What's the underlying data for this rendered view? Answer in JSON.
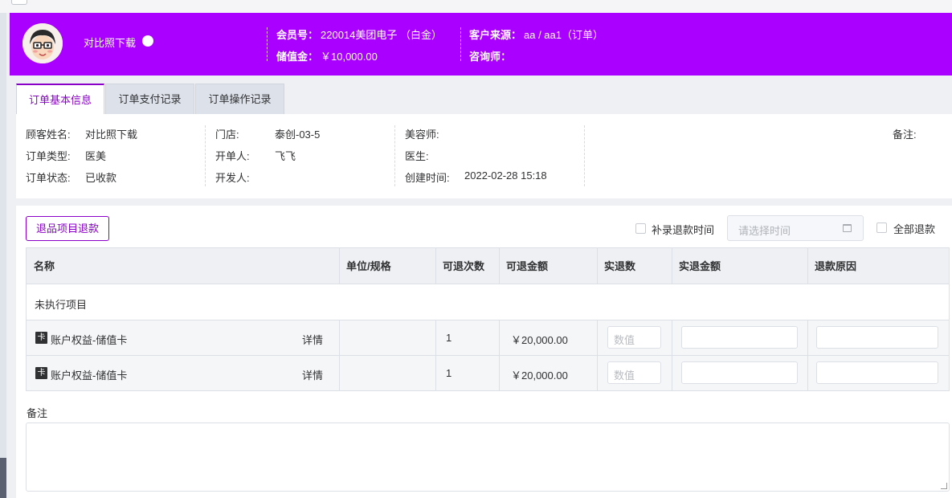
{
  "header": {
    "customer_name": "对比照下载",
    "member_label": "会员号：",
    "member_value": "220014美团电子 （白金）",
    "balance_label": "储值金：",
    "balance_value": "￥10,000.00",
    "source_label": "客户来源：",
    "source_value": "aa / aa1（订单）",
    "consultant_label": "咨询师：",
    "consultant_value": "",
    "bg_color": "#aa00ff"
  },
  "tabs": [
    {
      "label": "订单基本信息",
      "active": true
    },
    {
      "label": "订单支付记录",
      "active": false
    },
    {
      "label": "订单操作记录",
      "active": false
    }
  ],
  "info": {
    "customer_name_label": "顾客姓名:",
    "customer_name_value": "对比照下载",
    "order_type_label": "订单类型:",
    "order_type_value": "医美",
    "order_status_label": "订单状态:",
    "order_status_value": "已收款",
    "store_label": "门店:",
    "store_value": "泰创-03-5",
    "issuer_label": "开单人:",
    "issuer_value": "飞飞",
    "developer_label": "开发人:",
    "developer_value": "",
    "beautician_label": "美容师:",
    "beautician_value": "",
    "doctor_label": "医生:",
    "doctor_value": "",
    "created_label": "创建时间:",
    "created_value": "2022-02-28 15:18",
    "remark_label": "备注:"
  },
  "toolbar": {
    "refund_button": "退品项目退款",
    "supplement_time_label": "补录退款时间",
    "date_placeholder": "请选择时间",
    "full_refund_label": "全部退款"
  },
  "table": {
    "columns": [
      "名称",
      "单位/规格",
      "可退次数",
      "可退金额",
      "实退数",
      "实退金额",
      "退款原因"
    ],
    "group_label": "未执行项目",
    "rows": [
      {
        "card_icon": "卡",
        "name": "账户权益-储值卡",
        "detail": "详情",
        "unit": "",
        "count": "1",
        "amount": "￥20,000.00",
        "qty_placeholder": "数值"
      },
      {
        "card_icon": "卡",
        "name": "账户权益-储值卡",
        "detail": "详情",
        "unit": "",
        "count": "1",
        "amount": "￥20,000.00",
        "qty_placeholder": "数值"
      }
    ]
  },
  "remark": {
    "label": "备注"
  },
  "accent_color": "#8a00c8"
}
